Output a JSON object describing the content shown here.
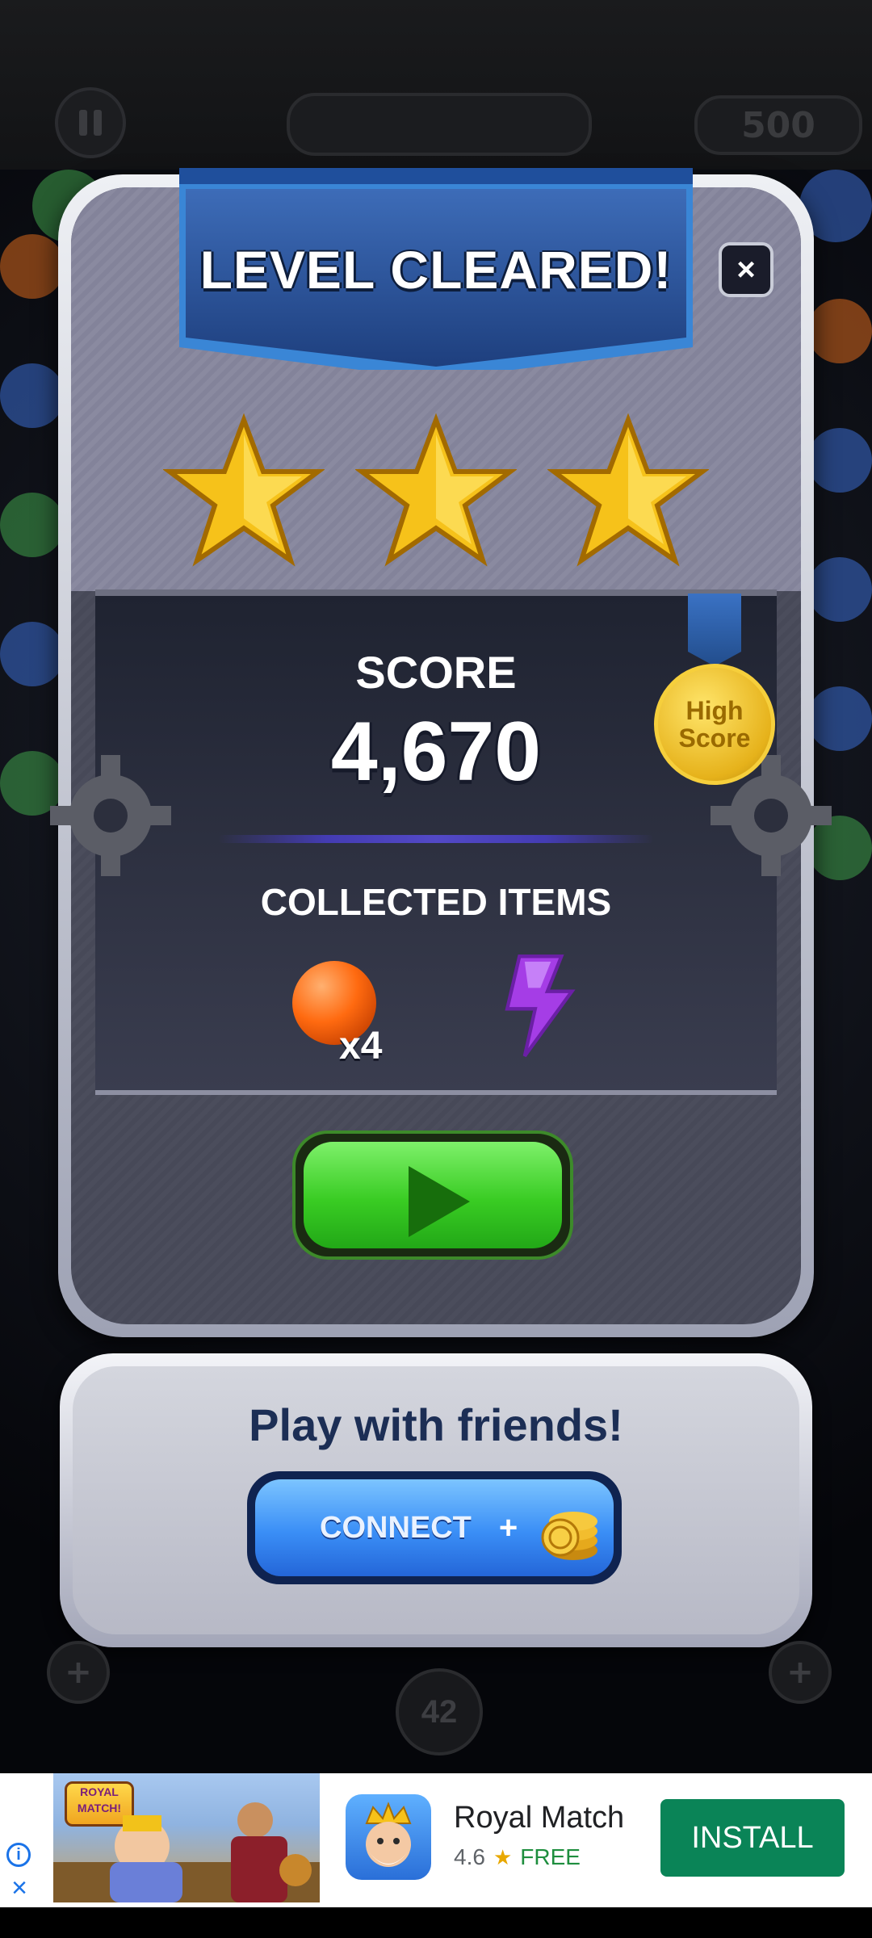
{
  "hud": {
    "score": "500"
  },
  "dialog": {
    "title": "LEVEL CLEARED!",
    "close_label": "×",
    "stars_earned": 3,
    "stars_total": 3,
    "score_label": "SCORE",
    "score_value": "4,670",
    "medal_text_line1": "High",
    "medal_text_line2": "Score",
    "collected_label": "COLLECTED ITEMS",
    "collected_items": [
      {
        "icon": "orange-orb-icon",
        "count": "x4"
      },
      {
        "icon": "purple-lightning-icon",
        "count": ""
      }
    ]
  },
  "friends": {
    "title": "Play with friends!",
    "connect_label": "CONNECT",
    "plus": "+"
  },
  "board": {
    "level": "42",
    "plus_left": "+",
    "plus_right": "+"
  },
  "ad": {
    "image_badge_line1": "ROYAL",
    "image_badge_line2": "MATCH!",
    "app_name": "Royal Match",
    "rating": "4.6",
    "price": "FREE",
    "install_label": "INSTALL",
    "info_icon": "i",
    "close_icon": "×"
  },
  "colors": {
    "install_button": "#0a8457",
    "play_button": "#39cc23",
    "connect_button": "#3a8ef6",
    "star": "#f6c21a"
  }
}
